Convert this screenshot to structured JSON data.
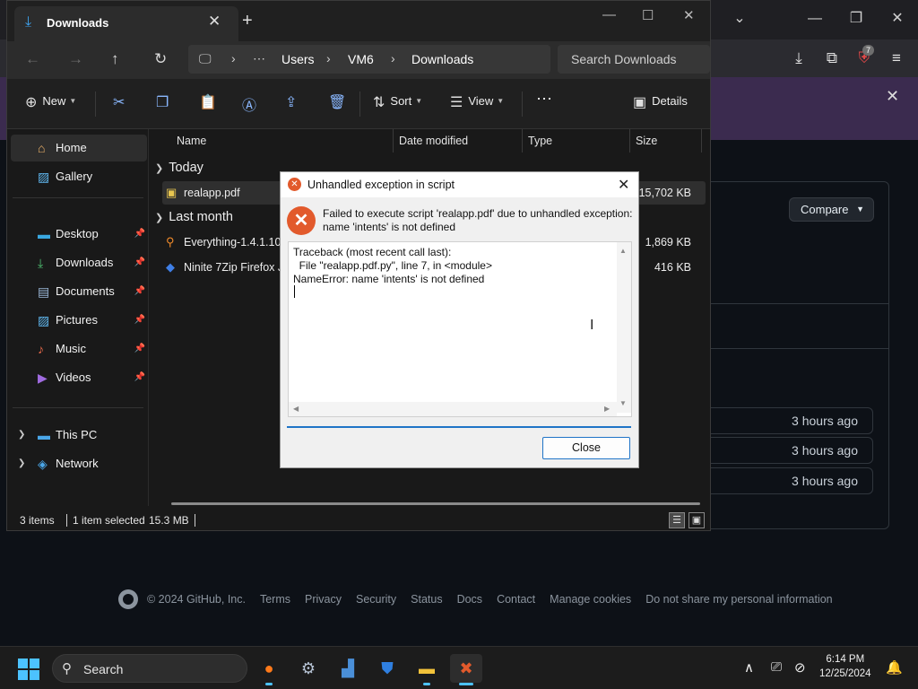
{
  "explorer": {
    "tab_title": "Downloads",
    "breadcrumb": [
      "Users",
      "VM6",
      "Downloads"
    ],
    "search_placeholder": "Search Downloads",
    "toolbar": {
      "new_label": "New",
      "sort_label": "Sort",
      "view_label": "View",
      "details_label": "Details"
    },
    "sidebar": [
      {
        "label": "Home",
        "icon": "home-icon"
      },
      {
        "label": "Gallery",
        "icon": "gallery-icon"
      },
      {
        "label": "Desktop",
        "icon": "desktop-icon"
      },
      {
        "label": "Downloads",
        "icon": "download-icon"
      },
      {
        "label": "Documents",
        "icon": "documents-icon"
      },
      {
        "label": "Pictures",
        "icon": "pictures-icon"
      },
      {
        "label": "Music",
        "icon": "music-icon"
      },
      {
        "label": "Videos",
        "icon": "videos-icon"
      },
      {
        "label": "This PC",
        "icon": "pc-icon"
      },
      {
        "label": "Network",
        "icon": "network-icon"
      }
    ],
    "columns": [
      "Name",
      "Date modified",
      "Type",
      "Size"
    ],
    "groups": [
      {
        "label": "Today",
        "files": [
          {
            "name": "realapp.pdf",
            "size": "15,702 KB"
          }
        ]
      },
      {
        "label": "Last month",
        "files": [
          {
            "name": "Everything-1.4.1.102",
            "size": "1,869 KB"
          },
          {
            "name": "Ninite 7Zip Firefox Ja",
            "size": "416 KB"
          }
        ]
      }
    ],
    "status": {
      "items": "3 items",
      "selected": "1 item selected",
      "size": "15.3 MB"
    }
  },
  "dialog": {
    "title": "Unhandled exception in script",
    "message": "Failed to execute script 'realapp.pdf' due to unhandled exception: name 'intents' is not defined",
    "traceback": "Traceback (most recent call last):\n  File \"realapp.pdf.py\", line 7, in <module>\nNameError: name 'intents' is not defined",
    "close_label": "Close"
  },
  "browser": {
    "compare_label": "Compare",
    "extension_badge": "7",
    "times": [
      "3 hours ago",
      "3 hours ago",
      "3 hours ago"
    ],
    "footer": [
      "© 2024 GitHub, Inc.",
      "Terms",
      "Privacy",
      "Security",
      "Status",
      "Docs",
      "Contact",
      "Manage cookies",
      "Do not share my personal information"
    ]
  },
  "taskbar": {
    "search_label": "Search",
    "time": "6:14 PM",
    "date": "12/25/2024"
  },
  "colors": {
    "accent": "#4cc2ff",
    "error": "#e25a2c",
    "dialog_accent": "#1f74c7"
  }
}
